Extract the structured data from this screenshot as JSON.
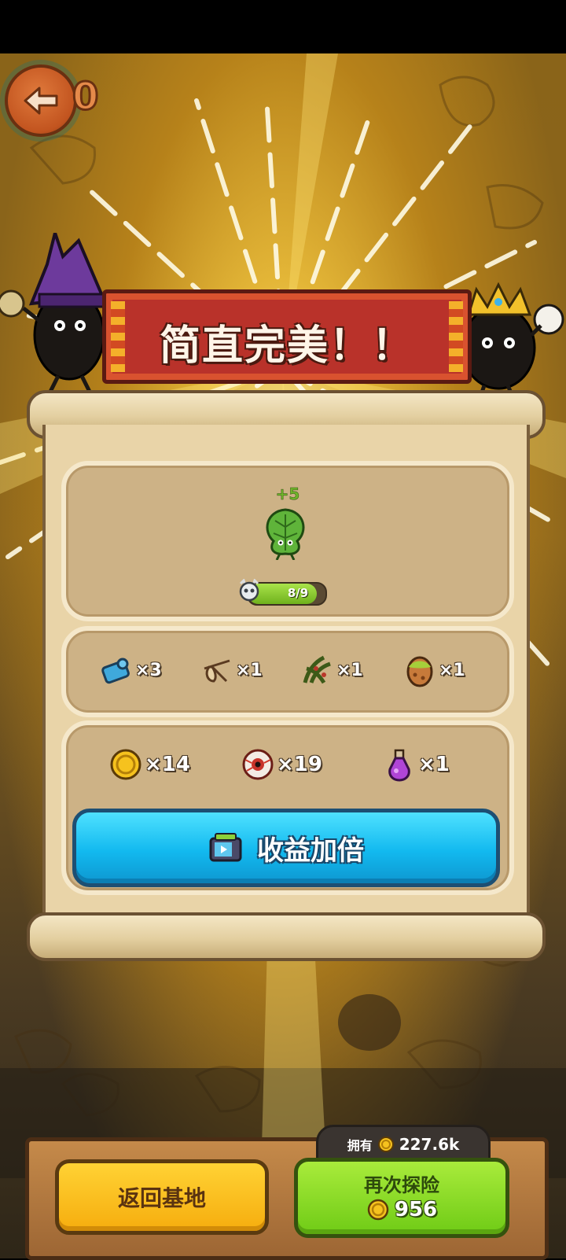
{
  "header": {
    "back_count": "0"
  },
  "banner": {
    "title": "简直完美！！"
  },
  "reward_card": {
    "bonus": "+5",
    "plant_icon": "leafy-plant-creature",
    "level_text": "8/9",
    "level_progress": 0.89,
    "level_fill_color": "#8ccf2f"
  },
  "materials": [
    {
      "icon": "blue-gear-part-icon",
      "count": "×3"
    },
    {
      "icon": "slingshot-icon",
      "count": "×1"
    },
    {
      "icon": "thorny-vine-icon",
      "count": "×1"
    },
    {
      "icon": "spotted-egg-icon",
      "count": "×1"
    }
  ],
  "loot": [
    {
      "icon": "gold-coin-icon",
      "count": "×14"
    },
    {
      "icon": "eyeball-icon",
      "count": "×19"
    },
    {
      "icon": "purple-potion-icon",
      "count": "×1"
    }
  ],
  "double_button": {
    "label": "收益加倍",
    "icon": "video-tv-icon",
    "color": "#12b9ef"
  },
  "footer": {
    "owned_label": "拥有",
    "owned_value": "227.6k",
    "home_label": "返回基地",
    "again_label": "再次探险",
    "again_cost": "956",
    "home_color": "#f8b91a",
    "again_color": "#8fdc25"
  }
}
